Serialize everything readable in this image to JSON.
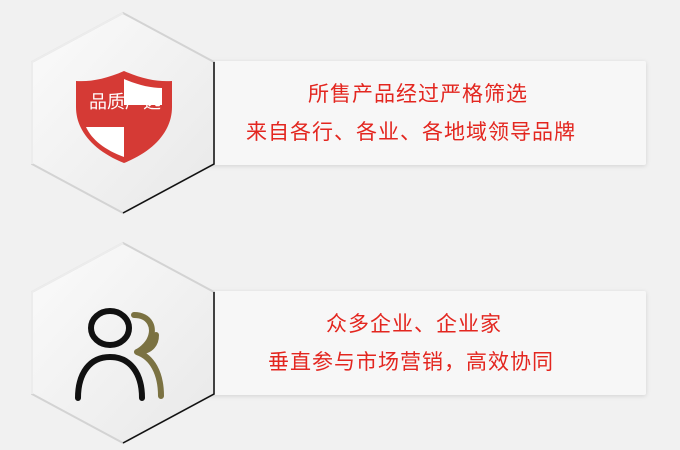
{
  "colors": {
    "background": "#f1f1f1",
    "card": "#f7f7f7",
    "accent_red": "#e3261f",
    "shield_red": "#d53a35",
    "person_dark": "#111111",
    "person_olive": "#7b7242"
  },
  "features": [
    {
      "icon": "quality-shield-icon",
      "icon_text": "品质严选",
      "lines": [
        "所售产品经过严格筛选",
        "来自各行、各业、各地域领导品牌"
      ]
    },
    {
      "icon": "people-group-icon",
      "lines": [
        "众多企业、企业家",
        "垂直参与市场营销，高效协同"
      ]
    }
  ]
}
